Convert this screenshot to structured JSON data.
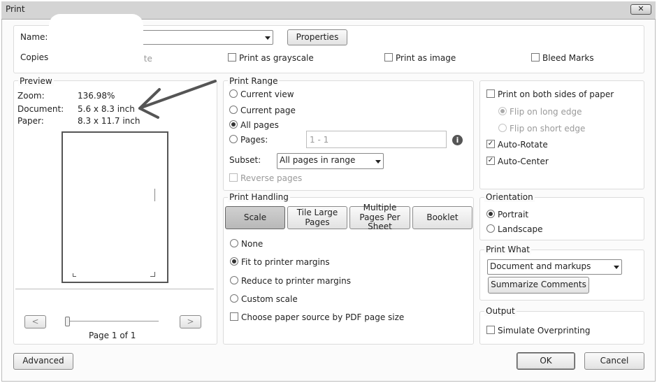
{
  "window": {
    "title": "Print",
    "close_glyph": "✕"
  },
  "top": {
    "name_label": "Name:",
    "properties_button": "Properties",
    "copies_label": "Copies:",
    "collate_label": "Collate",
    "grayscale_label": "Print as grayscale",
    "image_label": "Print as image",
    "bleed_label": "Bleed Marks"
  },
  "preview": {
    "title": "Preview",
    "zoom_label": "Zoom:",
    "zoom_value": "136.98%",
    "document_label": "Document:",
    "document_value": "5.6 x 8.3 inch",
    "paper_label": "Paper:",
    "paper_value": "8.3 x 11.7 inch",
    "prev_glyph": "<",
    "next_glyph": ">",
    "page_text": "Page 1 of 1"
  },
  "print_range": {
    "title": "Print Range",
    "current_view": "Current view",
    "current_page": "Current page",
    "all_pages": "All pages",
    "pages": "Pages:",
    "pages_placeholder": "1 - 1",
    "subset_label": "Subset:",
    "subset_value": "All pages in range",
    "reverse_pages": "Reverse pages",
    "selected": "all_pages"
  },
  "print_handling": {
    "title": "Print Handling",
    "tabs": {
      "scale": "Scale",
      "tile": "Tile Large Pages",
      "multiple": "Multiple Pages Per Sheet",
      "booklet": "Booklet"
    },
    "active_tab": "Scale",
    "none": "None",
    "fit": "Fit to printer margins",
    "reduce": "Reduce to printer margins",
    "custom": "Custom scale",
    "paper_source": "Choose paper source by PDF page size",
    "selected": "fit"
  },
  "duplex": {
    "both_sides": "Print on both sides of paper",
    "flip_long": "Flip on long edge",
    "flip_short": "Flip on short edge",
    "auto_rotate": "Auto-Rotate",
    "auto_center": "Auto-Center"
  },
  "orientation": {
    "title": "Orientation",
    "portrait": "Portrait",
    "landscape": "Landscape",
    "selected": "portrait"
  },
  "print_what": {
    "title": "Print What",
    "value": "Document and markups",
    "summarize_button": "Summarize Comments"
  },
  "output": {
    "title": "Output",
    "simulate": "Simulate Overprinting"
  },
  "footer": {
    "advanced_button": "Advanced",
    "ok_button": "OK",
    "cancel_button": "Cancel"
  },
  "check_glyph": "✓",
  "colors": {
    "arrow": "#555555",
    "dialog_bg": "#fbfbfb",
    "titlebar": "#d4d4d4"
  }
}
